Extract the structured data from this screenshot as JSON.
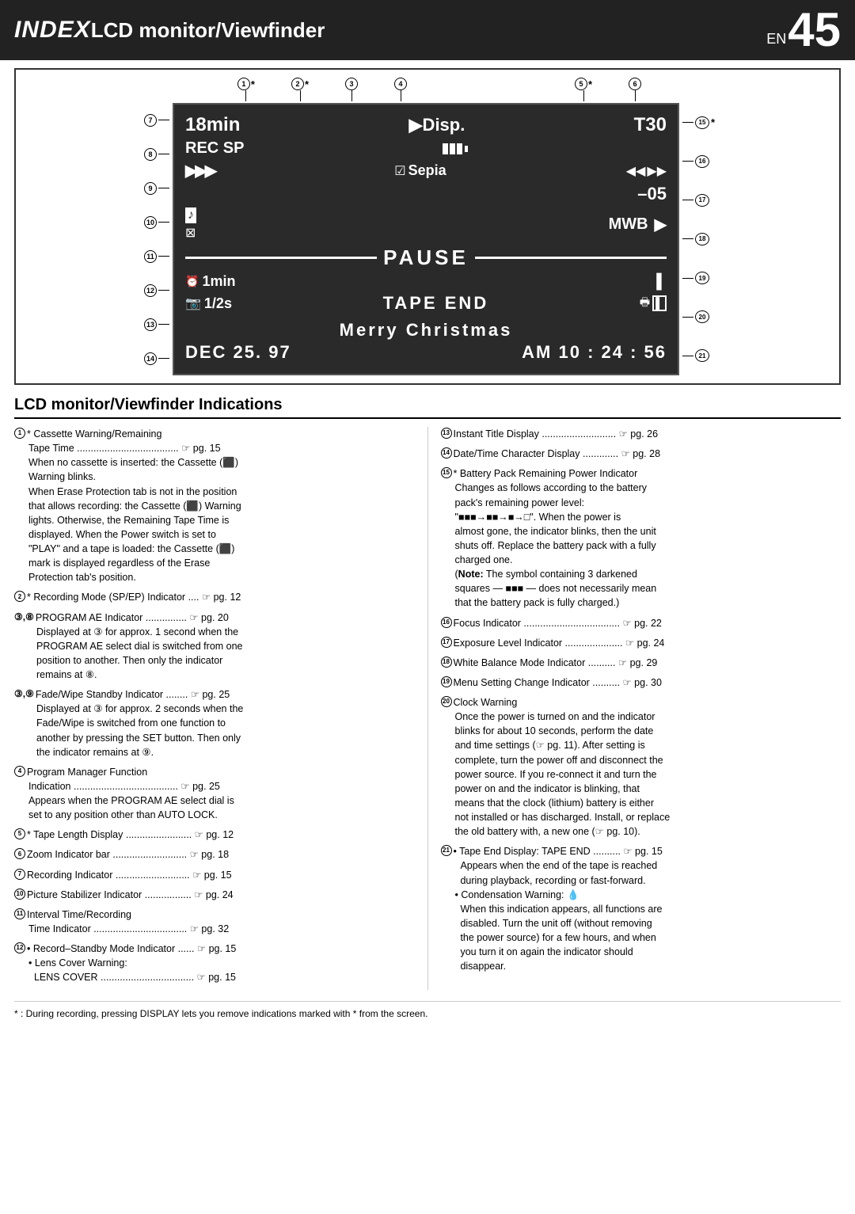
{
  "header": {
    "title_italic": "INDEX",
    "title_rest": " LCD monitor/Viewfinder",
    "en_label": "EN",
    "page_number": "45"
  },
  "lcd_display": {
    "row1": {
      "time": "18min",
      "disp": "▶Disp.",
      "t30": "T30"
    },
    "row2": {
      "rec_sp": "REC SP",
      "battery": "■■■"
    },
    "row3": {
      "arrows": "▶▶▶",
      "sepia_check": "☑",
      "sepia": "Sepia",
      "right_arrows": "◀◀▶▶"
    },
    "row4_blank": "",
    "row4_minus": "–05",
    "row5": {
      "grid": "⊠",
      "mwb": "MWB"
    },
    "pause": "≡ PAUSE ≡",
    "row7": {
      "clock": "⏰",
      "time_left": "1min"
    },
    "row8": {
      "cam_icon": "📷",
      "half_s": "1/2s",
      "tape_end": "TAPE  END",
      "print_icon": "🖶"
    },
    "row9": {
      "blank": ""
    },
    "merry": "Merry  Christmas",
    "date": "DEC  25. 97",
    "time_code": "AM 10 : 24 : 56"
  },
  "top_callouts": [
    {
      "num": "1",
      "star": true
    },
    {
      "num": "2",
      "star": true
    },
    {
      "num": "3",
      "star": false
    },
    {
      "num": "4",
      "star": false
    },
    {
      "num": "5",
      "star": true
    },
    {
      "num": "6",
      "star": false
    }
  ],
  "right_callouts": [
    {
      "num": "15",
      "star": true
    },
    {
      "num": "16",
      "star": false
    },
    {
      "num": "17",
      "star": false
    },
    {
      "num": "18",
      "star": false
    },
    {
      "num": "19",
      "star": false
    },
    {
      "num": "20",
      "star": false
    },
    {
      "num": "21",
      "star": false
    }
  ],
  "left_callouts": [
    {
      "num": "7",
      "star": false
    },
    {
      "num": "8",
      "star": false
    },
    {
      "num": "9",
      "star": false
    },
    {
      "num": "10",
      "star": false
    },
    {
      "num": "11",
      "star": false
    },
    {
      "num": "12",
      "star": false
    },
    {
      "num": "13",
      "star": false
    },
    {
      "num": "14",
      "star": false
    }
  ],
  "section_title": "LCD monitor/Viewfinder Indications",
  "left_items": [
    {
      "num": "①",
      "header": "* Cassette Warning/Remaining",
      "lines": [
        "Tape Time ..................................... ☞ pg. 15",
        "When no cassette is inserted: the Cassette (⬛)",
        "Warning blinks.",
        "When Erase Protection tab is not in the position",
        "that allows recording: the Cassette (⬛) Warning",
        "lights. Otherwise, the Remaining Tape Time is",
        "displayed. When the Power switch is set to",
        "\"PLAY\" and a tape is loaded: the Cassette (⬛)",
        "mark is displayed regardless of the Erase",
        "Protection tab's position."
      ]
    },
    {
      "num": "②",
      "header": "* Recording Mode (SP/EP) Indicator .... ☞ pg. 12"
    },
    {
      "num": "③⑧",
      "header": "PROGRAM AE Indicator ............... ☞ pg. 20",
      "lines": [
        "Displayed at ③ for approx. 1 second when the",
        "PROGRAM AE select dial is switched from one",
        "position to another. Then only the indicator",
        "remains at ⑧."
      ]
    },
    {
      "num": "③⑨",
      "header": "Fade/Wipe Standby Indicator ........ ☞ pg. 25",
      "lines": [
        "Displayed at ③ for approx. 2 seconds when the",
        "Fade/Wipe is switched from one function to",
        "another by pressing the SET button. Then only",
        "the indicator remains at ⑨."
      ]
    },
    {
      "num": "④",
      "header": "Program Manager Function",
      "lines": [
        "Indication ...................................... ☞ pg. 25",
        "Appears when the PROGRAM AE select dial is",
        "set to any position other than AUTO LOCK."
      ]
    },
    {
      "num": "⑤",
      "header": "* Tape Length Display ........................ ☞ pg. 12"
    },
    {
      "num": "⑥",
      "header": "Zoom Indicator bar ........................... ☞ pg. 18"
    },
    {
      "num": "⑦",
      "header": "Recording Indicator ........................... ☞ pg. 15"
    },
    {
      "num": "⑩",
      "header": "Picture Stabilizer Indicator ................. ☞ pg. 24"
    },
    {
      "num": "⑪",
      "header": "Interval Time/Recording",
      "lines": [
        "Time Indicator .................................. ☞ pg. 32"
      ]
    },
    {
      "num": "⑫",
      "header": "• Record–Standby Mode Indicator ...... ☞ pg. 15",
      "lines": [
        "• Lens Cover Warning:",
        "  LENS COVER .................................. ☞ pg. 15"
      ]
    }
  ],
  "right_items": [
    {
      "num": "⑬",
      "header": "Instant Title Display ........................... ☞ pg. 26"
    },
    {
      "num": "⑭",
      "header": "Date/Time Character Display ............. ☞ pg. 28"
    },
    {
      "num": "⑮",
      "header": "* Battery Pack Remaining Power Indicator",
      "lines": [
        "Changes as follows according to the battery",
        "pack's remaining power level:",
        "\"■■■→■■→■→□\". When the power is",
        "almost gone, the indicator blinks, then the unit",
        "shuts off. Replace the battery pack with a fully",
        "charged one.",
        "(Note:  The symbol containing 3 darkened",
        "squares — ■■■ — does not necessarily mean",
        "that the battery pack is fully charged.)"
      ]
    },
    {
      "num": "⑯",
      "header": "Focus Indicator ................................... ☞ pg. 22"
    },
    {
      "num": "⑰",
      "header": "Exposure Level Indicator ..................... ☞ pg. 24"
    },
    {
      "num": "⑱",
      "header": "White Balance Mode Indicator .......... ☞ pg. 29"
    },
    {
      "num": "⑲",
      "header": "Menu Setting Change Indicator .......... ☞ pg. 30"
    },
    {
      "num": "⑳",
      "header": "Clock Warning",
      "lines": [
        "Once the power is turned on and the indicator",
        "blinks for about 10 seconds, perform the date",
        "and time settings (☞ pg. 11). After setting is",
        "complete, turn the power off and disconnect the",
        "power source. If you re-connect it and turn the",
        "power on and the indicator is blinking, that",
        "means that the clock (lithium) battery is either",
        "not installed or has discharged. Install, or replace",
        "the old battery with, a new one (☞ pg. 10)."
      ]
    },
    {
      "num": "㉑",
      "header": "• Tape End Display: TAPE END .......... ☞ pg. 15",
      "lines": [
        "  Appears when the end of the tape is reached",
        "  during playback, recording or fast-forward.",
        "• Condensation Warning: 💧",
        "  When this indication appears, all functions are",
        "  disabled. Turn the unit off (without removing",
        "  the power source) for a few hours, and when",
        "  you turn it on again the indicator should",
        "  disappear."
      ]
    }
  ],
  "footer": "* : During recording, pressing DISPLAY lets you remove indications marked with * from the screen."
}
